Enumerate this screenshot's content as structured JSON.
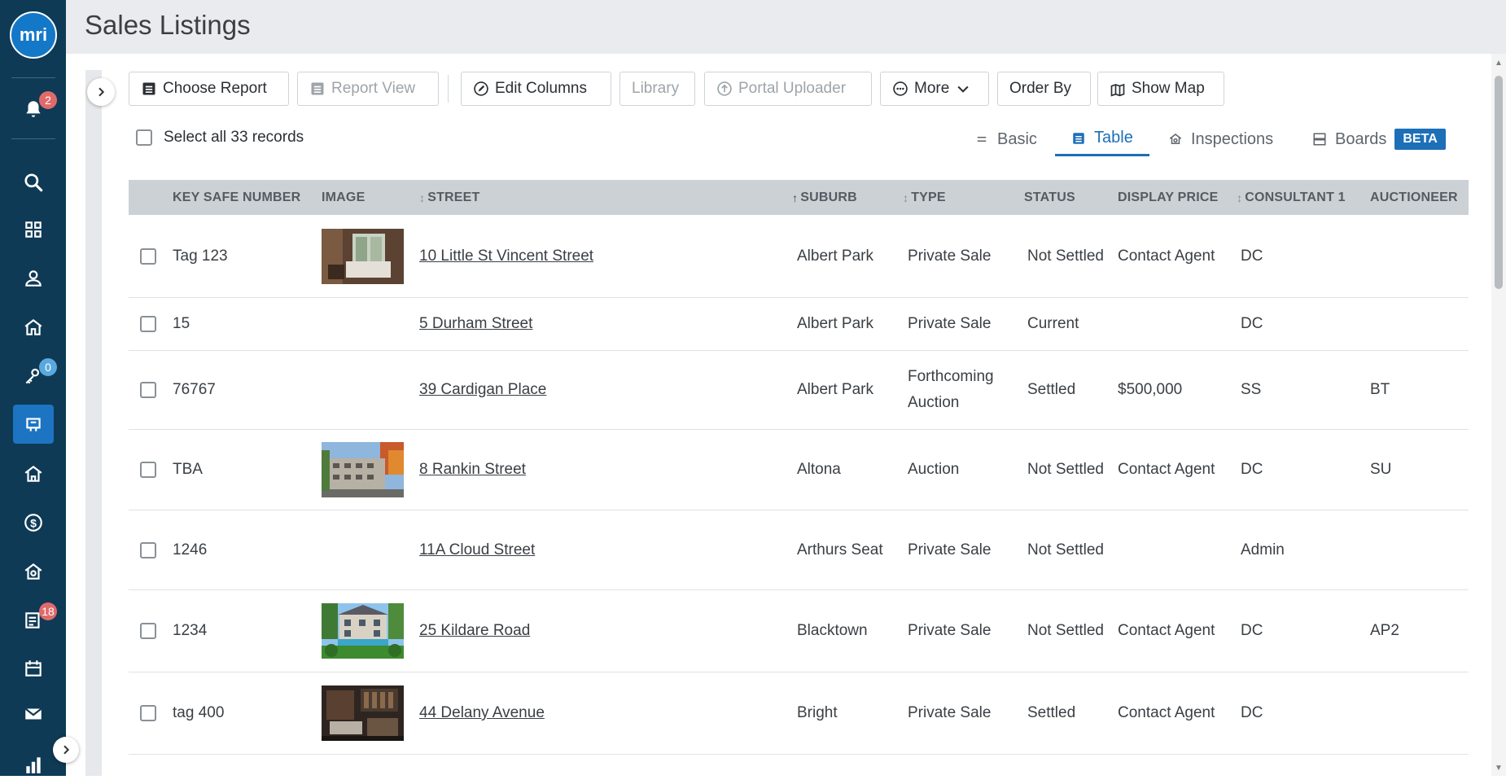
{
  "app": {
    "logo_text": "mri",
    "page_title": "Sales Listings"
  },
  "sidebar": {
    "items": [
      {
        "name": "notifications-icon",
        "badge": "2",
        "badge_color": "red"
      },
      {
        "name": "search-icon"
      },
      {
        "name": "dashboard-icon"
      },
      {
        "name": "contacts-icon"
      },
      {
        "name": "properties-icon"
      },
      {
        "name": "leads-icon",
        "badge": "0",
        "badge_color": "blue"
      },
      {
        "name": "sales-listings-icon",
        "active": true
      },
      {
        "name": "rentals-icon"
      },
      {
        "name": "finance-icon"
      },
      {
        "name": "inspections-icon"
      },
      {
        "name": "tasks-icon",
        "badge": "18",
        "badge_color": "red"
      },
      {
        "name": "calendar-icon"
      },
      {
        "name": "mail-icon"
      },
      {
        "name": "reports-icon"
      }
    ]
  },
  "toolbar": {
    "choose_report": "Choose Report",
    "report_view": "Report View",
    "edit_columns": "Edit Columns",
    "library": "Library",
    "portal_uploader": "Portal Uploader",
    "more": "More",
    "order_by": "Order By",
    "show_map": "Show Map"
  },
  "select_all": {
    "label": "Select all 33 records"
  },
  "view_tabs": {
    "basic": "Basic",
    "table": "Table",
    "inspections": "Inspections",
    "boards": "Boards",
    "beta": "BETA",
    "active": "Table"
  },
  "table": {
    "headers": {
      "key_safe": "KEY SAFE NUMBER",
      "image": "IMAGE",
      "street": "STREET",
      "suburb": "SUBURB",
      "type": "TYPE",
      "status": "STATUS",
      "display_price": "DISPLAY PRICE",
      "consultant": "CONSULTANT 1",
      "auctioneer": "AUCTIONEER"
    },
    "rows": [
      {
        "key": "Tag 123",
        "image": "living-room",
        "street": "10 Little St Vincent Street",
        "suburb": "Albert Park",
        "type": "Private Sale",
        "status": "Not Settled",
        "price": "Contact Agent",
        "consultant": "DC",
        "auctioneer": ""
      },
      {
        "key": "15",
        "image": "",
        "street": "5 Durham Street",
        "suburb": "Albert Park",
        "type": "Private Sale",
        "status": "Current",
        "price": "",
        "consultant": "DC",
        "auctioneer": ""
      },
      {
        "key": "76767",
        "image": "",
        "street": "39 Cardigan Place",
        "suburb": "Albert Park",
        "type": "Forthcoming Auction",
        "status": "Settled",
        "price": "$500,000",
        "consultant": "SS",
        "auctioneer": "BT"
      },
      {
        "key": "TBA",
        "image": "apartment-building",
        "street": "8 Rankin Street",
        "suburb": "Altona",
        "type": "Auction",
        "status": "Not Settled",
        "price": "Contact Agent",
        "consultant": "DC",
        "auctioneer": "SU"
      },
      {
        "key": "1246",
        "image": "",
        "street": "11A Cloud Street",
        "suburb": "Arthurs Seat",
        "type": "Private Sale",
        "status": "Not Settled",
        "price": "",
        "consultant": "Admin",
        "auctioneer": ""
      },
      {
        "key": "1234",
        "image": "mansion-garden",
        "street": "25 Kildare Road",
        "suburb": "Blacktown",
        "type": "Private Sale",
        "status": "Not Settled",
        "price": "Contact Agent",
        "consultant": "DC",
        "auctioneer": "AP2"
      },
      {
        "key": "tag 400",
        "image": "dark-interior",
        "street": "44 Delany Avenue",
        "suburb": "Bright",
        "type": "Private Sale",
        "status": "Settled",
        "price": "Contact Agent",
        "consultant": "DC",
        "auctioneer": ""
      }
    ]
  },
  "colors": {
    "sidebar": "#0e3a55",
    "accent": "#1d6fb8",
    "header_bg": "#ccd1d6"
  }
}
